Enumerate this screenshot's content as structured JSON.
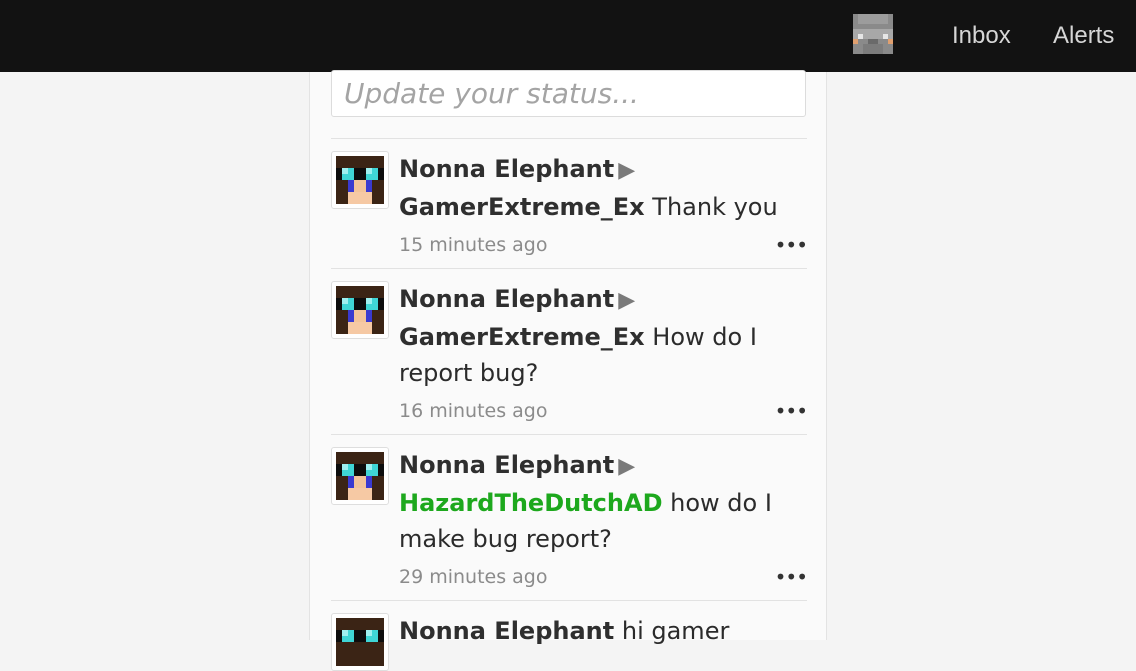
{
  "topbar": {
    "inbox_label": "Inbox",
    "alerts_label": "Alerts"
  },
  "status": {
    "placeholder": "Update your status..."
  },
  "posts": [
    {
      "author": "Nonna Elephant",
      "arrow": "▶",
      "target": "GamerExtreme_Ex",
      "message": "Thank you",
      "time": "15 minutes ago",
      "more": "•••"
    },
    {
      "author": "Nonna Elephant",
      "arrow": "▶",
      "target": "GamerExtreme_Ex",
      "message": "How do I report bug?",
      "time": "16 minutes ago",
      "more": "•••"
    },
    {
      "author": "Nonna Elephant",
      "arrow": "▶",
      "target": "HazardTheDutchAD",
      "message": "how do I make bug report?",
      "time": "29 minutes ago",
      "more": "•••"
    },
    {
      "author": "Nonna Elephant",
      "message": "hi gamer"
    }
  ],
  "colors": {
    "topbar_bg": "#121212",
    "highlight_username": "#1da81d"
  }
}
